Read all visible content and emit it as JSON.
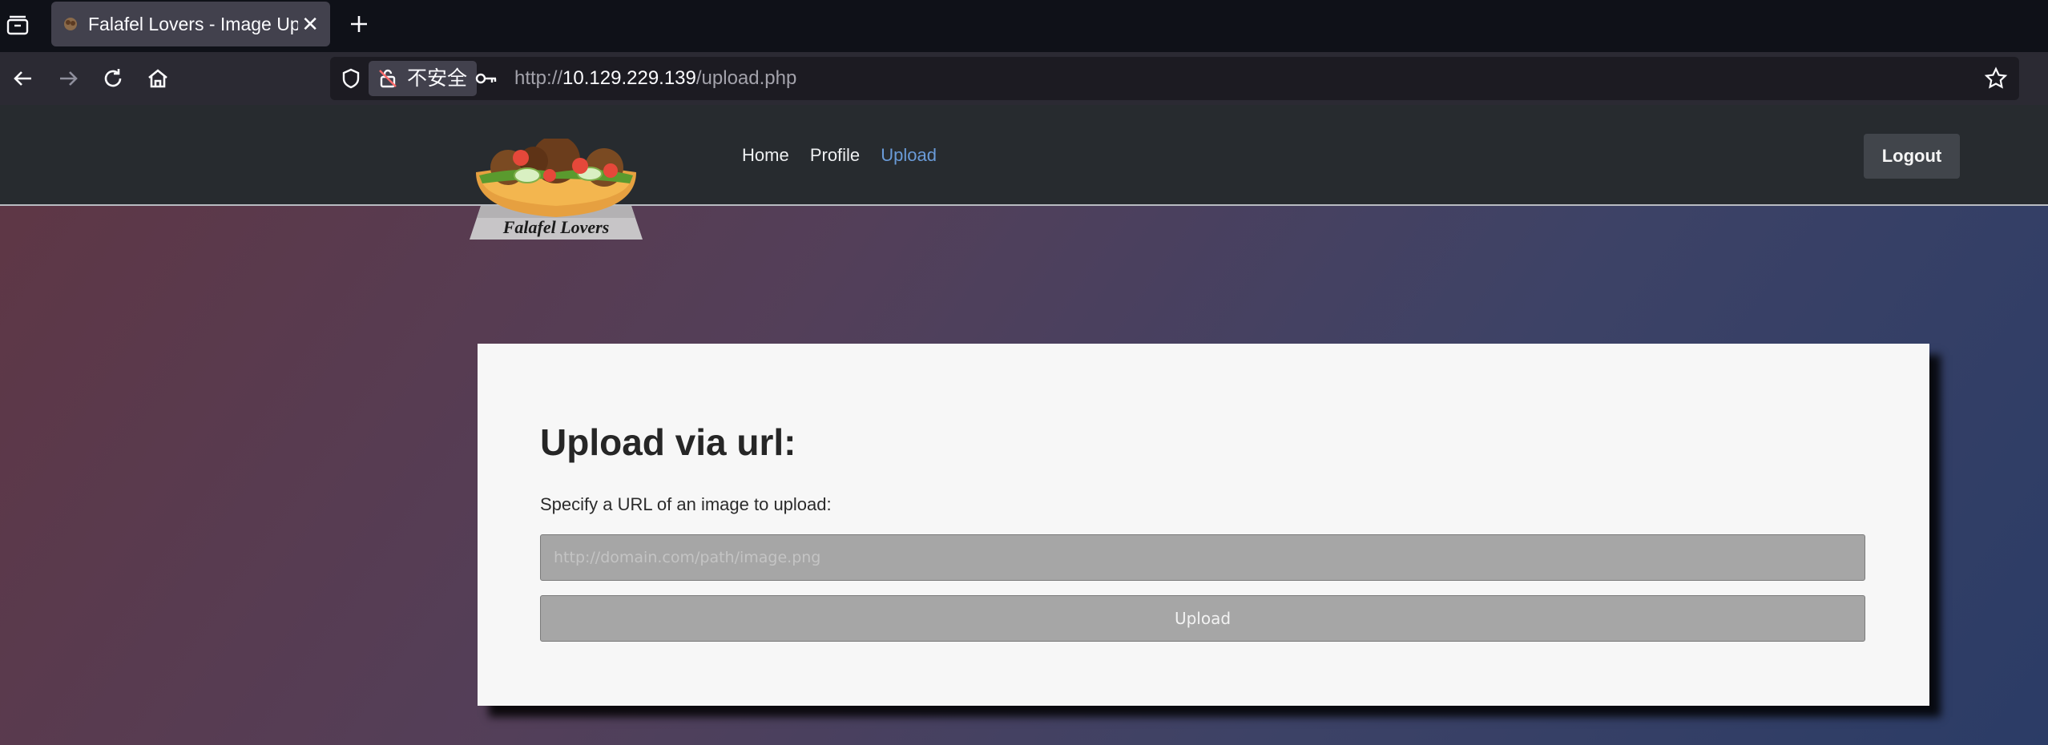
{
  "browser": {
    "tab": {
      "title": "Falafel Lovers - Image Upload",
      "close": "✕"
    },
    "new_tab": "+",
    "security_label": "不安全",
    "url": {
      "scheme": "http://",
      "host": "10.129.229.139",
      "path": "/upload.php"
    }
  },
  "site": {
    "nav": [
      {
        "label": "Home",
        "active": false
      },
      {
        "label": "Profile",
        "active": false
      },
      {
        "label": "Upload",
        "active": true
      }
    ],
    "logout_label": "Logout",
    "logo_text": "Falafel Lovers"
  },
  "upload": {
    "heading": "Upload via url:",
    "description": "Specify a URL of an image to upload:",
    "placeholder": "http://domain.com/path/image.png",
    "value": "",
    "button_label": "Upload"
  },
  "colors": {
    "accent_link": "#6a9bd8",
    "header_bg": "#272b2f",
    "card_bg": "#f7f7f7"
  }
}
